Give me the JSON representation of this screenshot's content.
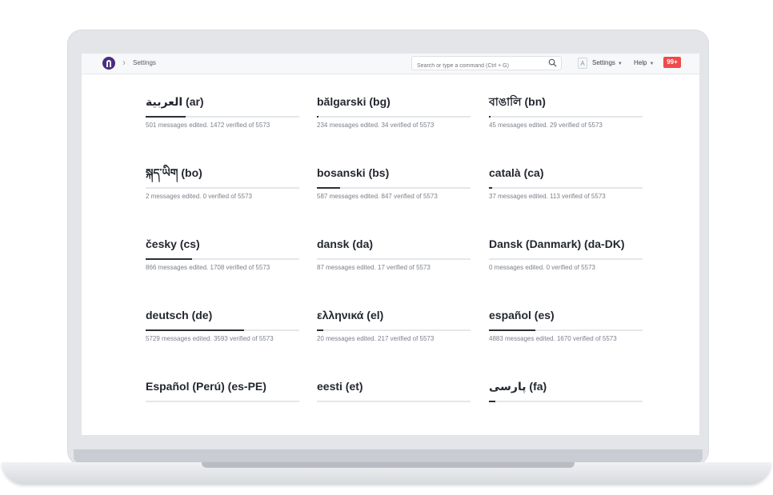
{
  "topbar": {
    "breadcrumb": "Settings",
    "search_placeholder": "Search or type a command (Ctrl + G)",
    "avatar_letter": "A",
    "settings_label": "Settings",
    "help_label": "Help",
    "notifications_badge": "99+"
  },
  "colors": {
    "badge": "#ef4b4b",
    "logo": "#4a2e7d",
    "progress": "#2b2f36"
  },
  "languages": [
    {
      "name": "العربية (ar)",
      "stats": "501 messages edited. 1472 verified of 5573",
      "progress": 0.26
    },
    {
      "name": "bălgarski (bg)",
      "stats": "234 messages edited. 34 verified of 5573",
      "progress": 0.01
    },
    {
      "name": "বাঙালি (bn)",
      "stats": "45 messages edited. 29 verified of 5573",
      "progress": 0.01
    },
    {
      "name": "སྐད་ཡིག (bo)",
      "stats": "2 messages edited. 0 verified of 5573",
      "progress": 0.0
    },
    {
      "name": "bosanski (bs)",
      "stats": "587 messages edited. 847 verified of 5573",
      "progress": 0.15
    },
    {
      "name": "català (ca)",
      "stats": "37 messages edited. 113 verified of 5573",
      "progress": 0.02
    },
    {
      "name": "česky (cs)",
      "stats": "866 messages edited. 1708 verified of 5573",
      "progress": 0.3
    },
    {
      "name": "dansk (da)",
      "stats": "87 messages edited. 17 verified of 5573",
      "progress": 0.0
    },
    {
      "name": "Dansk (Danmark) (da-DK)",
      "stats": "0 messages edited. 0 verified of 5573",
      "progress": 0.0
    },
    {
      "name": "deutsch (de)",
      "stats": "5729 messages edited. 3593 verified of 5573",
      "progress": 0.64
    },
    {
      "name": "ελληνικά (el)",
      "stats": "20 messages edited. 217 verified of 5573",
      "progress": 0.04
    },
    {
      "name": "español (es)",
      "stats": "4883 messages edited. 1670 verified of 5573",
      "progress": 0.3
    },
    {
      "name": "Español (Perú) (es-PE)",
      "stats": "",
      "progress": 0.0
    },
    {
      "name": "eesti (et)",
      "stats": "",
      "progress": 0.0
    },
    {
      "name": "پارسی (fa)",
      "stats": "",
      "progress": 0.04
    }
  ]
}
